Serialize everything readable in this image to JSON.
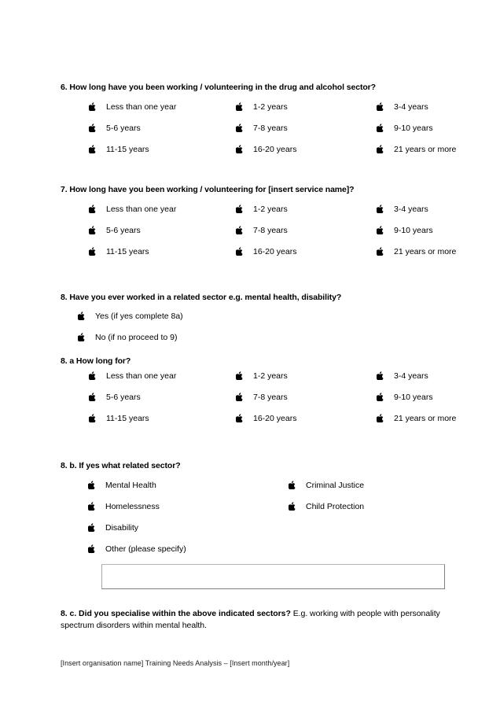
{
  "document": {
    "footer": "[Insert organisation name] Training Needs Analysis – [Insert month/year]"
  },
  "bullet_icon": "apple-logo-bullet",
  "questions": {
    "q6": {
      "number": "6.",
      "heading": "6. How long have you been working / volunteering in the drug and alcohol sector?",
      "options": [
        "Less than one year",
        "1-2 years",
        "3-4 years",
        "5-6 years",
        "7-8 years",
        "9-10 years",
        "11-15 years",
        "16-20 years",
        "21 years or more"
      ]
    },
    "q7": {
      "number": "7.",
      "heading": "7. How long have you been working / volunteering for [insert service name]?",
      "options": [
        "Less than one year",
        "1-2 years",
        "3-4 years",
        "5-6 years",
        "7-8 years",
        "9-10 years",
        "11-15 years",
        "16-20 years",
        "21 years or more"
      ]
    },
    "q8": {
      "number": "8.",
      "heading": "8. Have you ever worked in a related sector e.g. mental health, disability?",
      "options": [
        "Yes (if yes complete 8a)",
        "No (if no proceed to 9)"
      ]
    },
    "q8a": {
      "heading": "8. a How long for?",
      "options": [
        "Less than one year",
        "1-2 years",
        "3-4 years",
        "5-6 years",
        "7-8 years",
        "9-10 years",
        "11-15 years",
        "16-20 years",
        "21 years or more"
      ]
    },
    "q8b": {
      "heading": "8. b.  If yes what related sector?",
      "options_col1": [
        "Mental Health",
        "Homelessness",
        "Disability",
        "Other (please specify)"
      ],
      "options_col2": [
        "Criminal Justice",
        "Child Protection"
      ],
      "specify_value": "",
      "specify_placeholder": ""
    },
    "q8c": {
      "heading_bold": "8. c. Did you specialise within the above indicated sectors?",
      "heading_rest": " E.g. working with people with personality spectrum disorders within mental health."
    }
  }
}
